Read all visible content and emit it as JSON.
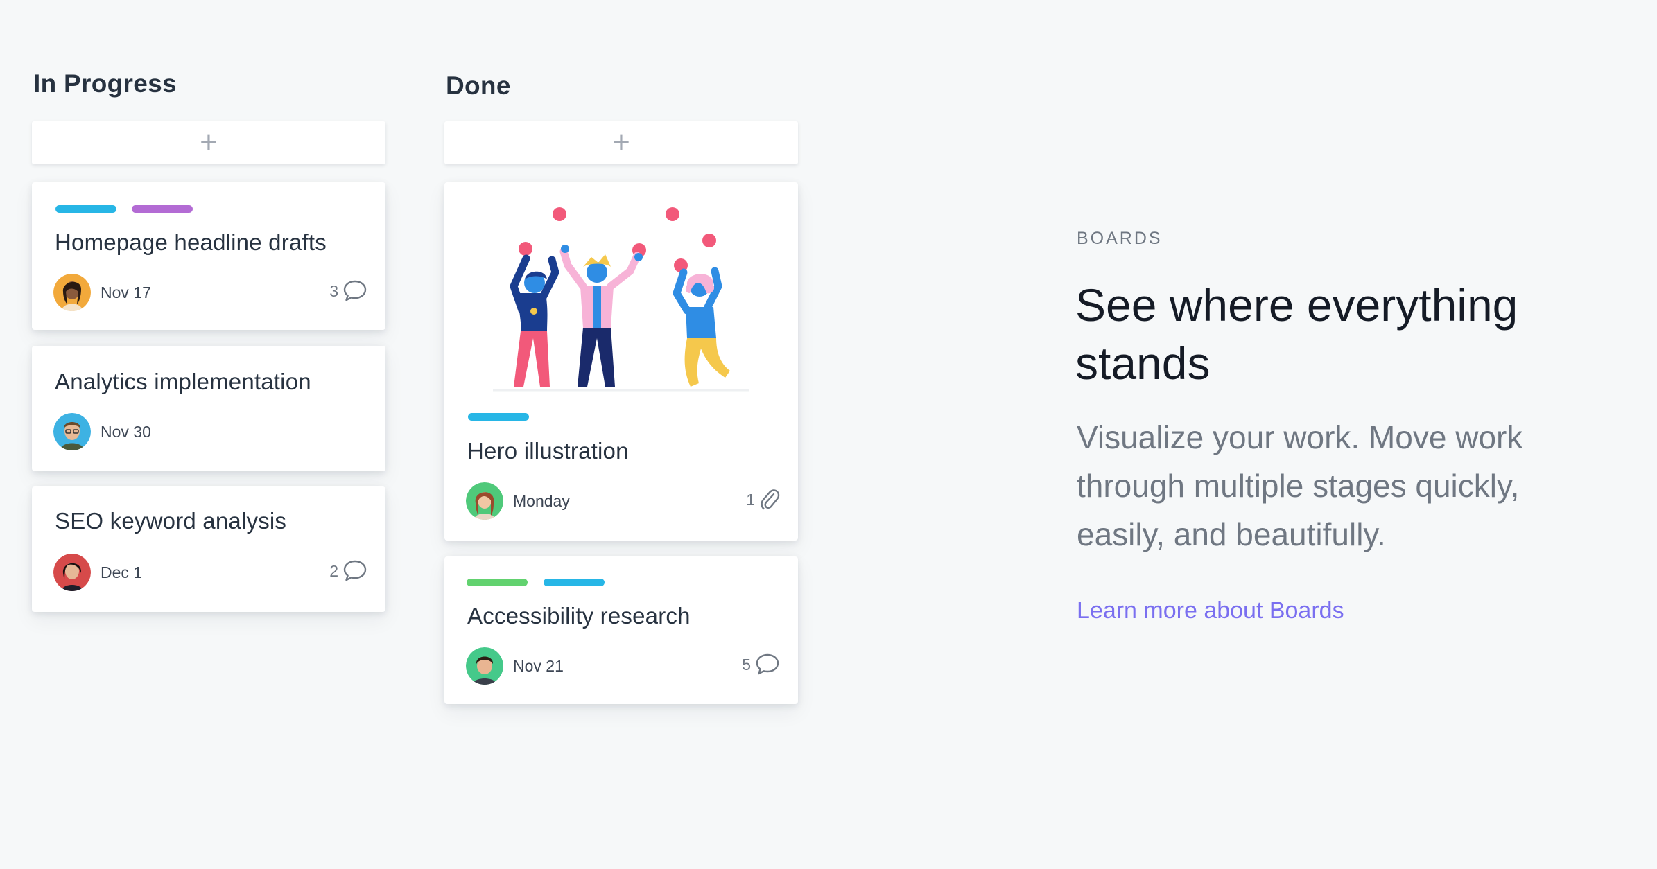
{
  "columns": [
    {
      "title": "In Progress",
      "add_label": "+",
      "cards": [
        {
          "title": "Homepage headline drafts",
          "due": "Nov 17",
          "count": "3",
          "meta_icon": "comment-icon",
          "tags": [
            "#27b6e6",
            "#b36bd4"
          ]
        },
        {
          "title": "Analytics implementation",
          "due": "Nov 30",
          "count": "",
          "meta_icon": "",
          "tags": []
        },
        {
          "title": "SEO keyword analysis",
          "due": "Dec 1",
          "count": "2",
          "meta_icon": "comment-icon",
          "tags": []
        }
      ]
    },
    {
      "title": "Done",
      "add_label": "+",
      "cards": [
        {
          "title": "Hero illustration",
          "due": "Monday",
          "count": "1",
          "meta_icon": "paperclip-icon",
          "tags": [
            "#27b6e6"
          ],
          "image": "celebration-illustration"
        },
        {
          "title": "Accessibility research",
          "due": "Nov 21",
          "count": "5",
          "meta_icon": "comment-icon",
          "tags": [
            "#62d26f",
            "#27b6e6"
          ]
        }
      ]
    }
  ],
  "feature": {
    "eyebrow": "BOARDS",
    "headline": "See where everything stands",
    "description": "Visualize your work. Move work through multiple stages quickly, easily, and beautifully.",
    "link": "Learn more about Boards"
  },
  "colors": {
    "background": "#f6f8f9",
    "link": "#7a6ff0",
    "tag_blue": "#27b6e6",
    "tag_purple": "#b36bd4",
    "tag_green": "#62d26f"
  }
}
